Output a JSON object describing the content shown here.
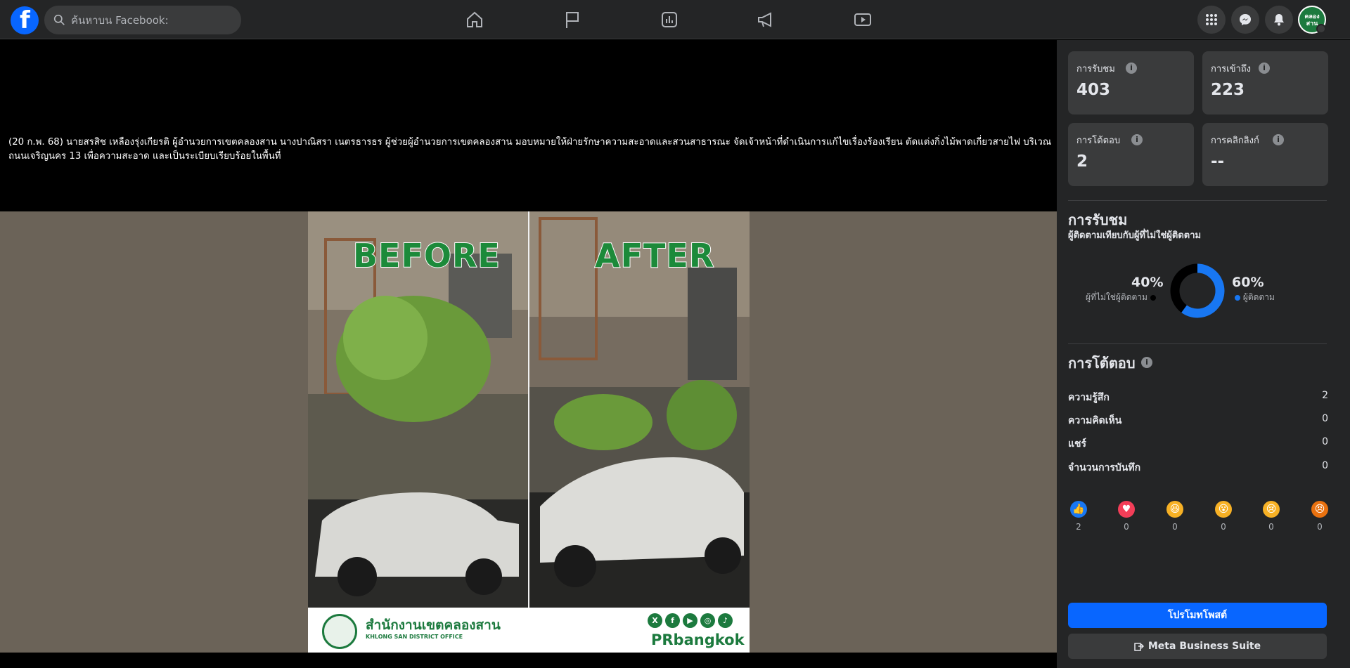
{
  "topbar": {
    "logo_letter": "f",
    "search_placeholder": "ค้นหาบน Facebook:",
    "nav_icons": [
      "home-icon",
      "pages-flag-icon",
      "insights-chart-icon",
      "ads-megaphone-icon",
      "watch-video-icon"
    ],
    "right_icons": [
      "menu-grid-icon",
      "messenger-icon",
      "notifications-bell-icon"
    ],
    "avatar_text": "คลอง สาน"
  },
  "post": {
    "caption": "(20 ก.พ. 68) นายสรสิช เหลืองรุ่งเกียรติ ผู้อำนวยการเขตคลองสาน นางปาณิสรา เนตรธารธร ผู้ช่วยผู้อำนวยการเขตคลองสาน มอบหมายให้ฝ่ายรักษาความสะอาดและสวนสาธารณะ จัดเจ้าหน้าที่ดำเนินการแก้ไขเรื่องร้องเรียน ตัดแต่งกิ่งไม้พาดเกี่ยวสายไฟ บริเวณถนนเจริญนคร 13 เพื่อความสะอาด และเป็นระเบียบเรียบร้อยในพื้นที่",
    "image": {
      "before_label": "BEFORE",
      "after_label": "AFTER",
      "office_name_th": "สำนักงานเขตคลองสาน",
      "office_name_en": "KHLONG SAN DISTRICT OFFICE",
      "social_glyphs": [
        "X",
        "f",
        "▶",
        "◎",
        "♪"
      ],
      "brand": "PRbangkok"
    }
  },
  "stats": [
    {
      "label": "การรับชม",
      "value": "403"
    },
    {
      "label": "การเข้าถึง",
      "value": "223"
    },
    {
      "label": "การโต้ตอบ",
      "value": "2"
    },
    {
      "label": "การคลิกลิงก์",
      "value": "--"
    }
  ],
  "info_glyph": "i",
  "views": {
    "title": "การรับชม",
    "subtitle": "ผู้ติดตามเทียบกับผู้ที่ไม่ใช่ผู้ติดตาม",
    "non_follower_pct": "40%",
    "non_follower_label": "ผู้ที่ไม่ใช่ผู้ติดตาม",
    "follower_pct": "60%",
    "follower_label": "ผู้ติดตาม",
    "follower_share": 0.6,
    "colors": {
      "follower": "#1877f2",
      "non_follower": "#000000"
    }
  },
  "engagement": {
    "title": "การโต้ตอบ",
    "rows": [
      {
        "label": "ความรู้สึก",
        "value": "2"
      },
      {
        "label": "ความคิดเห็น",
        "value": "0"
      },
      {
        "label": "แชร์",
        "value": "0"
      },
      {
        "label": "จำนวนการบันทึก",
        "value": "0"
      }
    ],
    "reactions": [
      {
        "name": "like-icon",
        "glyph": "👍",
        "count": "2",
        "color": "#1877f2"
      },
      {
        "name": "love-icon",
        "glyph": "♥",
        "count": "0",
        "color": "#f33e58"
      },
      {
        "name": "haha-icon",
        "glyph": "😆",
        "count": "0",
        "color": "#f7b125"
      },
      {
        "name": "wow-icon",
        "glyph": "😮",
        "count": "0",
        "color": "#f7b125"
      },
      {
        "name": "sad-icon",
        "glyph": "😢",
        "count": "0",
        "color": "#f7b125"
      },
      {
        "name": "angry-icon",
        "glyph": "😠",
        "count": "0",
        "color": "#e9710f"
      }
    ]
  },
  "buttons": {
    "promote": "โปรโมทโพสต์",
    "business_suite": "Meta Business Suite"
  }
}
